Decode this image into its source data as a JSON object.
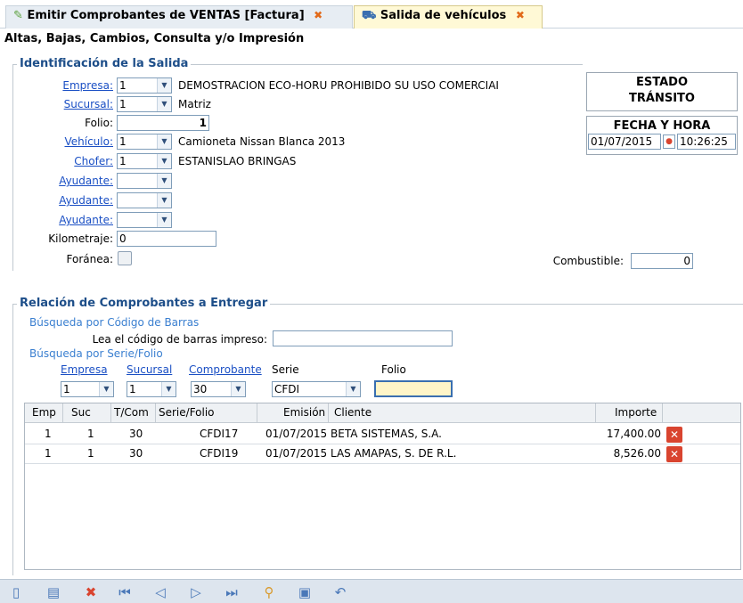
{
  "tabs": [
    {
      "label": "Emitir Comprobantes de VENTAS [Factura]",
      "close": "✖",
      "icon": "document-check-icon"
    },
    {
      "label": "Salida de vehículos",
      "close": "✖",
      "icon": "truck-icon"
    }
  ],
  "page_subtitle": "Altas, Bajas, Cambios, Consulta y/o Impresión",
  "identificacion": {
    "title": "Identificación de la Salida",
    "empresa_label": "Empresa:",
    "empresa_value": "1",
    "empresa_desc": "DEMOSTRACION ECO-HORU PROHIBIDO SU USO COMERCIAI",
    "sucursal_label": "Sucursal:",
    "sucursal_value": "1",
    "sucursal_desc": "Matriz",
    "folio_label": "Folio:",
    "folio_value": "1",
    "vehiculo_label": "Vehículo:",
    "vehiculo_value": "1",
    "vehiculo_desc": "Camioneta Nissan Blanca 2013",
    "chofer_label": "Chofer:",
    "chofer_value": "1",
    "chofer_desc": "ESTANISLAO BRINGAS",
    "ayudante1_label": "Ayudante:",
    "ayudante2_label": "Ayudante:",
    "ayudante3_label": "Ayudante:",
    "kilometraje_label": "Kilometraje:",
    "kilometraje_value": "0",
    "foranea_label": "Foránea:",
    "combustible_label": "Combustible:",
    "combustible_value": "0"
  },
  "estado": {
    "title": "ESTADO",
    "value": "TRÁNSITO"
  },
  "fecha_hora": {
    "title": "FECHA Y HORA",
    "date": "01/07/2015",
    "time": "10:26:25"
  },
  "relacion": {
    "title": "Relación de Comprobantes a Entregar",
    "barcode_heading": "Búsqueda por Código de Barras",
    "barcode_label": "Lea el código de barras impreso:",
    "barcode_value": "",
    "serie_heading": "Búsqueda por Serie/Folio",
    "empresa_label": "Empresa",
    "empresa_value": "1",
    "sucursal_label": "Sucursal",
    "sucursal_value": "1",
    "comprobante_label": "Comprobante",
    "comprobante_value": "30",
    "serie_label": "Serie",
    "serie_value": "CFDI",
    "folio_label": "Folio",
    "folio_value": ""
  },
  "grid": {
    "columns": [
      "Emp",
      "Suc",
      "T/Com",
      "Serie/Folio",
      "Emisión",
      "Cliente",
      "Importe"
    ],
    "rows": [
      {
        "emp": "1",
        "suc": "1",
        "tcom": "30",
        "serie_folio": "CFDI17",
        "emision": "01/07/2015",
        "cliente": "BETA SISTEMAS, S.A.",
        "importe": "17,400.00"
      },
      {
        "emp": "1",
        "suc": "1",
        "tcom": "30",
        "serie_folio": "CFDI19",
        "emision": "01/07/2015",
        "cliente": "LAS AMAPAS, S. DE R.L.",
        "importe": "8,526.00"
      }
    ],
    "delete_glyph": "✕"
  },
  "toolbar": {
    "new_glyph": "▯",
    "edit_glyph": "▤",
    "delete_glyph": "✖",
    "first_glyph": "⏮",
    "prev_glyph": "◁",
    "next_glyph": "▷",
    "last_glyph": "⏭",
    "search_glyph": "⚲",
    "save_glyph": "▣",
    "undo_glyph": "↶"
  },
  "colors": {
    "accent": "#1d4e89",
    "link": "#1a4fc4",
    "delete": "#d9442f",
    "folio_input": "#fff5c8"
  }
}
